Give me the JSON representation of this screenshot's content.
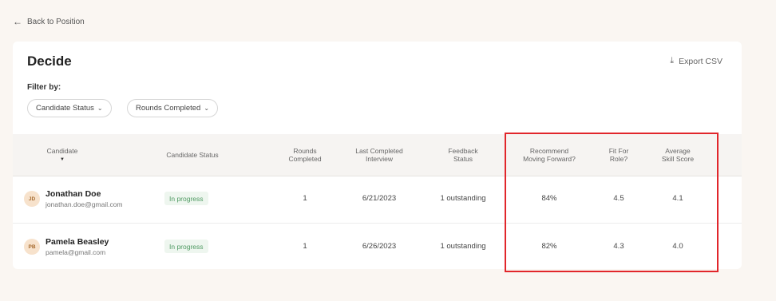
{
  "nav": {
    "back_label": "Back to Position"
  },
  "page": {
    "title": "Decide",
    "export_label": "Export CSV"
  },
  "filters": {
    "label": "Filter by:",
    "chips": [
      "Candidate Status",
      "Rounds Completed"
    ]
  },
  "table": {
    "headers": {
      "candidate": "Candidate",
      "status": "Candidate Status",
      "rounds_1": "Rounds",
      "rounds_2": "Completed",
      "last_1": "Last Completed",
      "last_2": "Interview",
      "feedback_1": "Feedback",
      "feedback_2": "Status",
      "recommend_1": "Recommend",
      "recommend_2": "Moving Forward?",
      "fit_1": "Fit For",
      "fit_2": "Role?",
      "skill_1": "Average",
      "skill_2": "Skill Score"
    },
    "rows": [
      {
        "initials": "JD",
        "name": "Jonathan Doe",
        "email": "jonathan.doe@gmail.com",
        "status": "In progress",
        "rounds": "1",
        "last_interview": "6/21/2023",
        "feedback": "1 outstanding",
        "recommend": "84%",
        "fit": "4.5",
        "skill": "4.1"
      },
      {
        "initials": "PB",
        "name": "Pamela Beasley",
        "email": "pamela@gmail.com",
        "status": "In progress",
        "rounds": "1",
        "last_interview": "6/26/2023",
        "feedback": "1 outstanding",
        "recommend": "82%",
        "fit": "4.3",
        "skill": "4.0"
      }
    ]
  },
  "colors": {
    "highlight": "#e1262b",
    "badge_text": "#4f9a62",
    "avatar_bg": "#f7e2cc"
  }
}
